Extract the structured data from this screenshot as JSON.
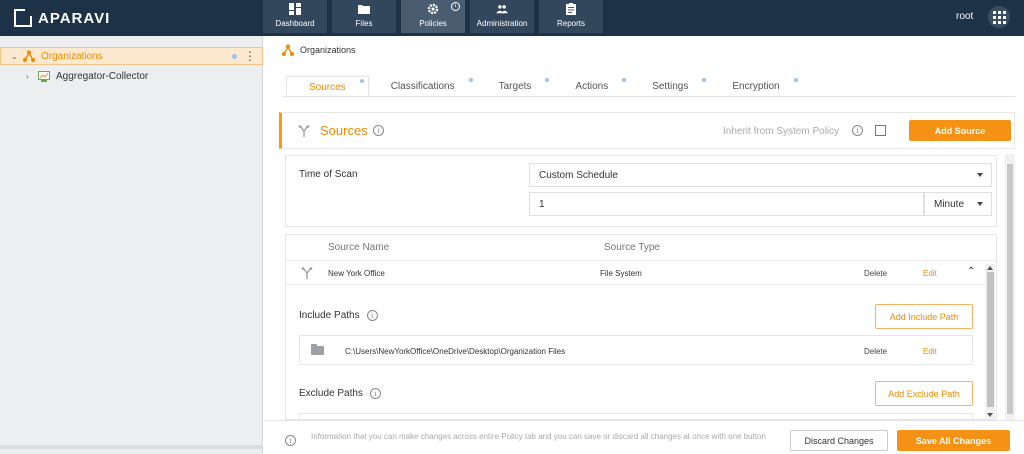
{
  "app": {
    "brand": "APARAVI",
    "user": "root"
  },
  "nav": [
    {
      "label": "Dashboard",
      "icon": "dashboard-icon"
    },
    {
      "label": "Files",
      "icon": "folder-icon"
    },
    {
      "label": "Policies",
      "icon": "gear-icon",
      "active": true
    },
    {
      "label": "Administration",
      "icon": "users-icon"
    },
    {
      "label": "Reports",
      "icon": "clipboard-icon"
    }
  ],
  "sidebar": {
    "items": [
      {
        "label": "Organizations",
        "selected": true
      },
      {
        "label": "Aggregator-Collector"
      }
    ]
  },
  "breadcrumb": {
    "label": "Organizations"
  },
  "tabs": [
    "Sources",
    "Classifications",
    "Targets",
    "Actions",
    "Settings",
    "Encryption"
  ],
  "sources": {
    "title": "Sources",
    "inherit_label": "Inherit from System Policy",
    "inherit_checked": false,
    "add_button": "Add Source"
  },
  "schedule": {
    "label": "Time of Scan",
    "mode": "Custom Schedule",
    "interval": "1",
    "unit": "Minute"
  },
  "table": {
    "col_name": "Source Name",
    "col_type": "Source Type",
    "rows": [
      {
        "name": "New York Office",
        "type": "File System",
        "delete": "Delete",
        "edit": "Edit"
      }
    ]
  },
  "include": {
    "label": "Include Paths",
    "add_button": "Add Include Path",
    "paths": [
      {
        "path": "C:\\Users\\NewYorkOffice\\OneDrive\\Desktop\\Organization Files",
        "delete": "Delete",
        "edit": "Edit"
      }
    ]
  },
  "exclude": {
    "label": "Exclude Paths",
    "add_button": "Add Exclude Path"
  },
  "footer": {
    "info": "Information that you can make changes across entire Policy tab and you can save or discard all changes at once with one button",
    "discard": "Discard Changes",
    "save": "Save All Changes"
  },
  "colors": {
    "topbar": "#1d3147",
    "accent": "#f59114",
    "accent_text": "#f08a00"
  }
}
